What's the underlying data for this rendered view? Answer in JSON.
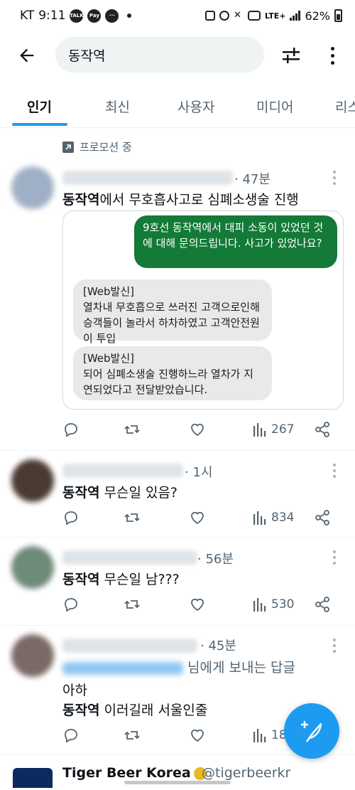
{
  "status_bar": {
    "carrier": "KT",
    "time": "9:11",
    "chip1": "TALK",
    "chip2": "Pay",
    "network": "LTE+",
    "battery": "62%"
  },
  "search": {
    "query": "동작역"
  },
  "tabs": [
    {
      "label": "인기"
    },
    {
      "label": "최신"
    },
    {
      "label": "사용자"
    },
    {
      "label": "미디어"
    },
    {
      "label": "리스"
    }
  ],
  "promoted": "프로모션 중",
  "tweets": [
    {
      "time": "· 47분",
      "highlight": "동작역",
      "text_rest": "에서 무호흡사고로 심폐소생술 진행",
      "media": {
        "sent": "9호선 동작역에서 대피 소동이 있었던 것에 대해 문의드립니다. 사고가 있었나요?",
        "reply1_tag": "[Web발신]",
        "reply1_body": "열차내 무호흡으로 쓰러진 고객으로인해 승객들이 놀라서 하차하였고 고객안전원이 투입",
        "reply2_tag": "[Web발신]",
        "reply2_body": "되어 심폐소생술 진행하느라 열차가 지연되었다고 전달받았습니다."
      },
      "views": "267"
    },
    {
      "time": "· 1시",
      "highlight": "동작역",
      "text_rest": " 무슨일 있음?",
      "views": "834"
    },
    {
      "time": "· 56분",
      "highlight": "동작역",
      "text_rest": " 무슨일 남???",
      "views": "530"
    },
    {
      "time": "· 45분",
      "reply_to": "님에게 보내는 답글",
      "line1": "아하",
      "highlight": "동작역",
      "text_rest": " 이러길래 서울인줄",
      "views": "18"
    }
  ],
  "bottom_tweet": {
    "name": "Tiger Beer Korea",
    "handle": "@tigerbeerkr"
  },
  "colors": {
    "accent": "#1d9bf0",
    "sms_green": "#137a37",
    "muted": "#536471"
  }
}
